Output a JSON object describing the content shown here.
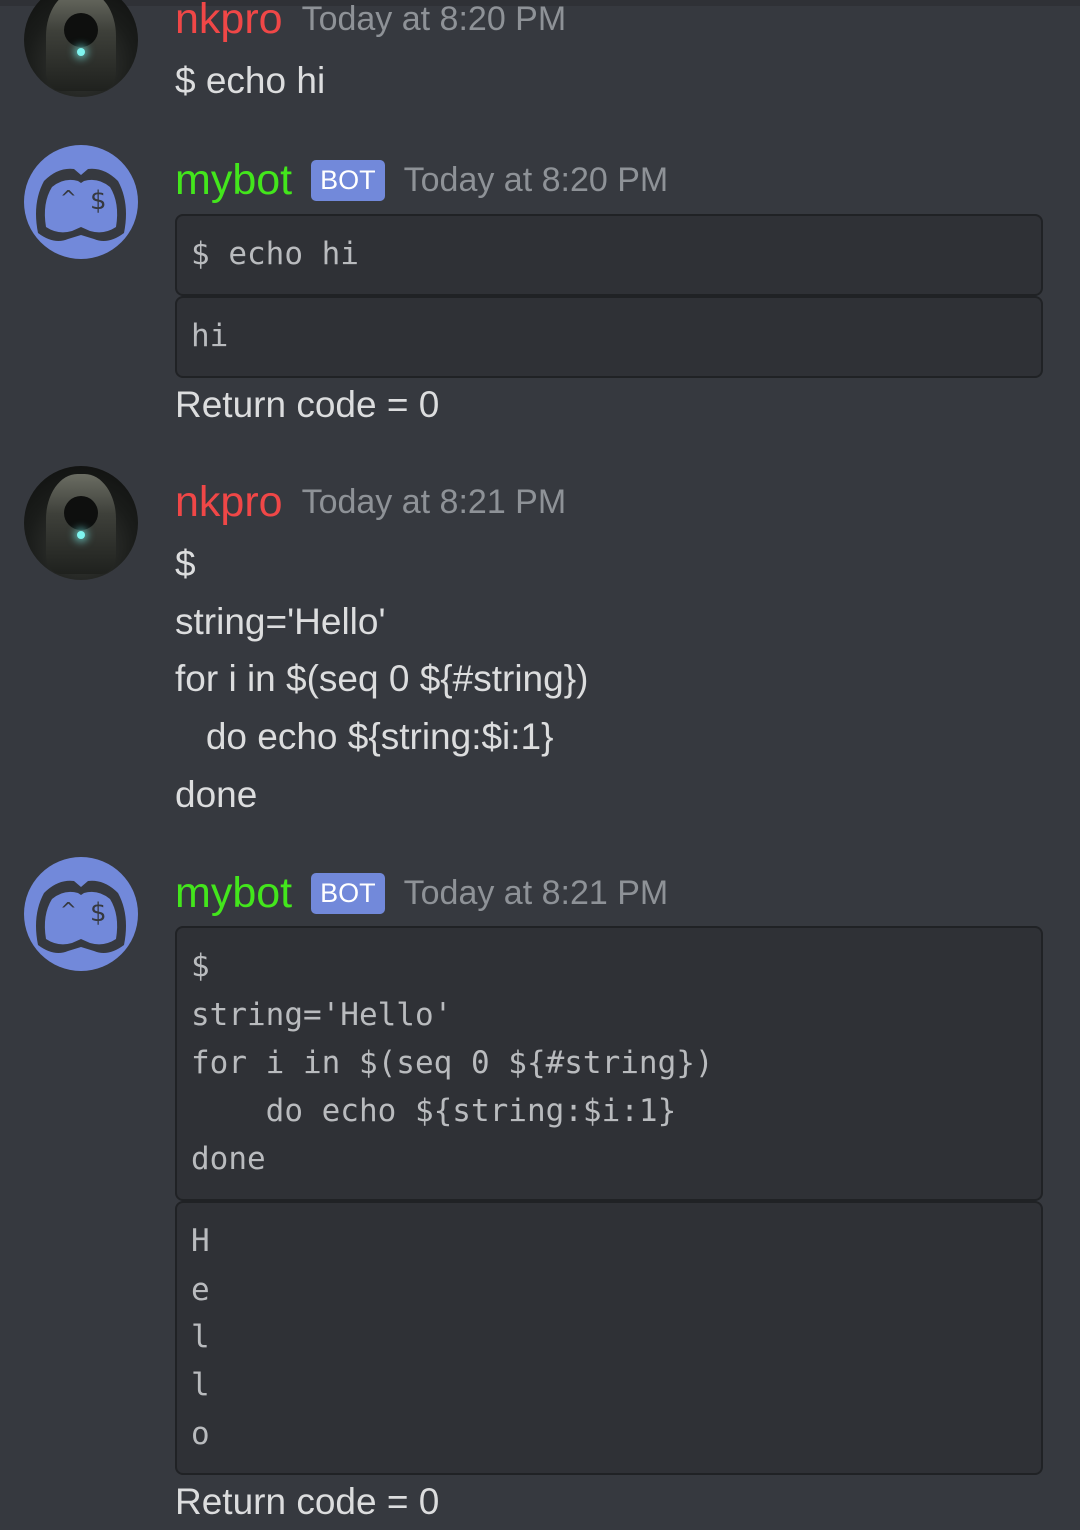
{
  "messages": [
    {
      "author": "nkpro",
      "timestamp": "Today at 8:20 PM",
      "lines": [
        "$ echo hi"
      ]
    },
    {
      "author": "mybot",
      "tag": "BOT",
      "timestamp": "Today at 8:20 PM",
      "command_block": [
        "$ echo hi"
      ],
      "output_block": [
        "hi"
      ],
      "footer": "Return code = 0"
    },
    {
      "author": "nkpro",
      "timestamp": "Today at 8:21 PM",
      "lines": [
        "$",
        "string='Hello'",
        "for i in $(seq 0 ${#string})",
        "   do echo ${string:$i:1}",
        "done"
      ]
    },
    {
      "author": "mybot",
      "tag": "BOT",
      "timestamp": "Today at 8:21 PM",
      "command_block": [
        "$",
        "string='Hello'",
        "for i in $(seq 0 ${#string})",
        "    do echo ${string:$i:1}",
        "done"
      ],
      "output_block": [
        "H",
        "e",
        "l",
        "l",
        "o"
      ],
      "footer": "Return code = 0"
    }
  ],
  "colors": {
    "background": "#36393f",
    "user_name": "#f04747",
    "bot_name": "#43e61c",
    "bot_tag": "#7289da",
    "timestamp": "#8e9297",
    "code_bg": "#2f3136"
  },
  "icons": {
    "user_avatar": "hooded-figure-avatar-icon",
    "bot_avatar": "discord-bot-avatar-icon"
  }
}
